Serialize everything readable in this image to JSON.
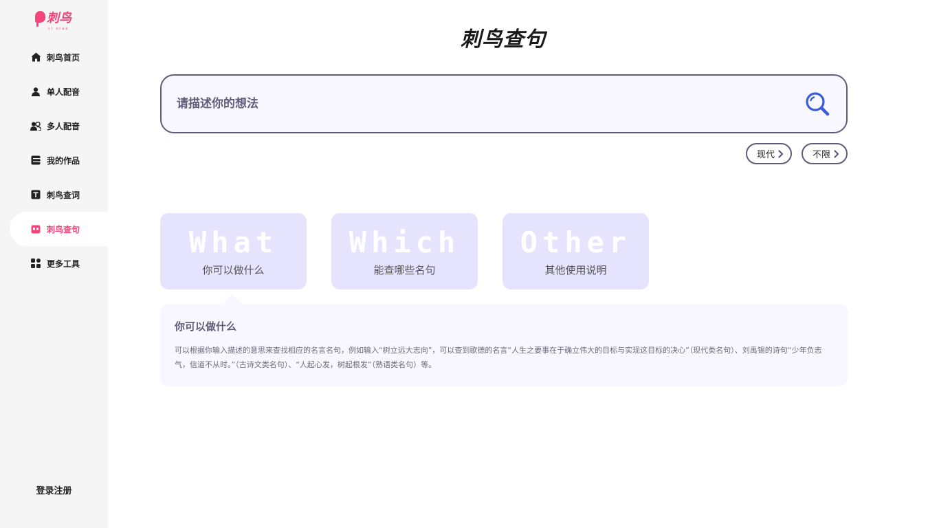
{
  "brand": {
    "name": "刺鸟",
    "pinyin": "ci niao",
    "color": "#f4457b"
  },
  "sidebar": {
    "items": [
      {
        "label": "刺鸟首页",
        "icon": "home-icon"
      },
      {
        "label": "单人配音",
        "icon": "person-icon"
      },
      {
        "label": "多人配音",
        "icon": "people-icon"
      },
      {
        "label": "我的作品",
        "icon": "works-icon"
      },
      {
        "label": "刺鸟查词",
        "icon": "text-t-icon"
      },
      {
        "label": "刺鸟查句",
        "icon": "quote-icon",
        "active": true
      },
      {
        "label": "更多工具",
        "icon": "grid-icon"
      }
    ],
    "login_label": "登录注册"
  },
  "main": {
    "title": "刺鸟查句",
    "search": {
      "placeholder": "请描述你的想法",
      "value": ""
    },
    "filters": [
      {
        "label": "现代"
      },
      {
        "label": "不限"
      }
    ],
    "cards": [
      {
        "bg_word": "What",
        "label": "你可以做什么",
        "selected": true
      },
      {
        "bg_word": "Which",
        "label": "能查哪些名句",
        "selected": false
      },
      {
        "bg_word": "Other",
        "label": "其他使用说明",
        "selected": false
      }
    ],
    "description": {
      "title": "你可以做什么",
      "text": "可以根据你输入描述的意思来查找相应的名言名句，例如输入“树立远大志向”，可以查到歌德的名言“人生之要事在于确立伟大的目标与实现这目标的决心”（现代类名句）、刘禹锡的诗句“少年负志气，信道不从时。”（古诗文类名句）、“人起心发，树起根发”（熟语类名句）等。"
    }
  },
  "colors": {
    "accent": "#f4457b",
    "border": "#5f5b78",
    "card_bg": "#e6e3ff",
    "panel_bg": "#f8f7ff",
    "search_icon": "#3b5bdb"
  }
}
